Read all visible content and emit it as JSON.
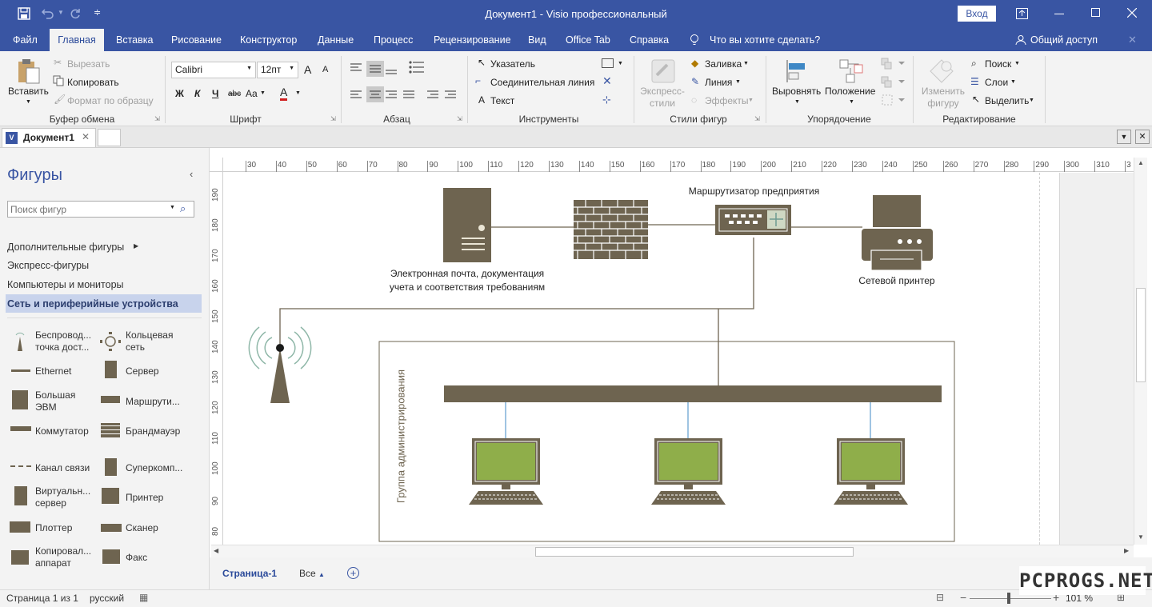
{
  "titlebar": {
    "title": "Документ1  -  Visio профессиональный",
    "login": "Вход",
    "colors": {
      "bar": "#3955a3"
    }
  },
  "ribbon_tabs": [
    "Файл",
    "Главная",
    "Вставка",
    "Рисование",
    "Конструктор",
    "Данные",
    "Процесс",
    "Рецензирование",
    "Вид",
    "Office Tab",
    "Справка"
  ],
  "tell_me": "Что вы хотите сделать?",
  "share": "Общий доступ",
  "ribbon": {
    "clipboard": {
      "paste": "Вставить",
      "cut": "Вырезать",
      "copy": "Копировать",
      "format_painter": "Формат по образцу",
      "label": "Буфер обмена"
    },
    "font": {
      "name": "Calibri",
      "size": "12пт",
      "bold": "Ж",
      "italic": "К",
      "underline": "Ч",
      "strike": "abc",
      "case": "Aa",
      "color_letter": "A",
      "grow": "A",
      "shrink": "A",
      "label": "Шрифт"
    },
    "paragraph": {
      "label": "Абзац"
    },
    "tools": {
      "pointer": "Указатель",
      "connector": "Соединительная линия",
      "text": "Текст",
      "label": "Инструменты"
    },
    "shape_styles": {
      "quick": "Экспресс-\nстили",
      "fill": "Заливка",
      "line": "Линия",
      "effects": "Эффекты",
      "label": "Стили фигур"
    },
    "arrange": {
      "align": "Выровнять",
      "position": "Положение",
      "label": "Упорядочение"
    },
    "editing": {
      "change": "Изменить\nфигуру",
      "find": "Поиск",
      "layers": "Слои",
      "select": "Выделить",
      "label": "Редактирование"
    }
  },
  "doc_tabs": {
    "active": "Документ1"
  },
  "shapes_panel": {
    "title": "Фигуры",
    "search_placeholder": "Поиск фигур",
    "categories": [
      "Дополнительные фигуры",
      "Экспресс-фигуры",
      "Компьютеры и мониторы",
      "Сеть и периферийные устройства"
    ],
    "stencils": [
      [
        "Беспровод...\nточка дост...",
        "Кольцевая\nсеть"
      ],
      [
        "Ethernet",
        "Сервер"
      ],
      [
        "Большая\nЭВМ",
        "Маршрути..."
      ],
      [
        "Коммутатор",
        "Брандмауэр"
      ],
      [
        "Канал связи",
        "Суперкомп..."
      ],
      [
        "Виртуальн...\nсервер",
        "Принтер"
      ],
      [
        "Плоттер",
        "Сканер"
      ],
      [
        "Копировал...\nаппарат",
        "Факс"
      ]
    ]
  },
  "ruler_h": [
    "30",
    "40",
    "50",
    "60",
    "70",
    "80",
    "90",
    "100",
    "110",
    "120",
    "130",
    "140",
    "150",
    "160",
    "170",
    "180",
    "190",
    "200",
    "210",
    "220",
    "230",
    "240",
    "250",
    "260",
    "270",
    "280",
    "290",
    "300",
    "310",
    "3"
  ],
  "ruler_v": [
    "190",
    "180",
    "170",
    "160",
    "150",
    "140",
    "130",
    "120",
    "110",
    "100",
    "90",
    "80"
  ],
  "diagram": {
    "server_label": "Электронная почта, документация\nучета и соответствия требованиям",
    "router_label": "Маршрутизатор предприятия",
    "printer_label": "Сетевой принтер",
    "group_label": "Группа администрирования",
    "colors": {
      "shape": "#6e6450",
      "screen": "#8fae4a",
      "blue_line": "#3f88c5"
    }
  },
  "page_tabs": {
    "page": "Страница-1",
    "all": "Все"
  },
  "status": {
    "page": "Страница 1 из 1",
    "lang": "русский",
    "zoom": "101 %"
  },
  "watermark": "PCPROGS.NET"
}
